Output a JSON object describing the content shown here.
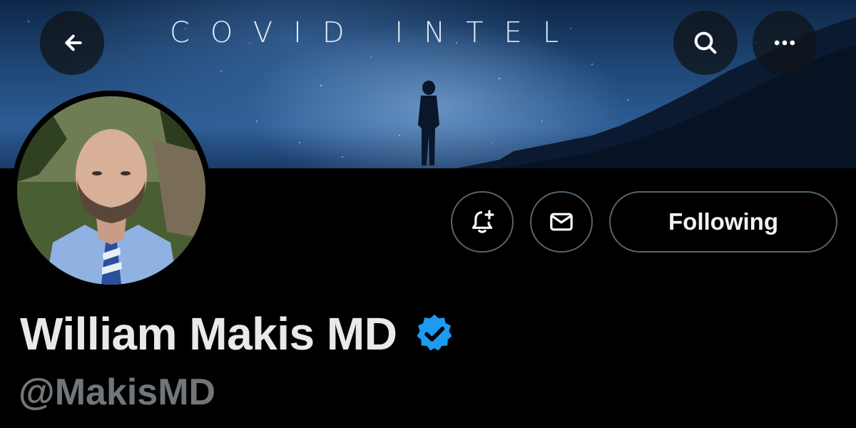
{
  "banner": {
    "title": "COVID INTEL",
    "colors": {
      "sky_top": "#0e2747",
      "sky_mid": "#2d5c94",
      "glow": "#96beeb"
    }
  },
  "top_actions": {
    "back_icon": "arrow-left-icon",
    "search_icon": "search-icon",
    "more_icon": "more-horizontal-icon"
  },
  "profile": {
    "display_name": "William Makis MD",
    "handle": "@MakisMD",
    "verified_icon": "verified-badge-icon",
    "verified_color": "#1d9bf0"
  },
  "actions": {
    "notifications_icon": "bell-plus-icon",
    "message_icon": "envelope-icon",
    "following_label": "Following"
  },
  "theme": {
    "background": "#000000",
    "text_primary": "#e7e9ea",
    "text_secondary": "#71767b",
    "button_border": "#536471"
  }
}
